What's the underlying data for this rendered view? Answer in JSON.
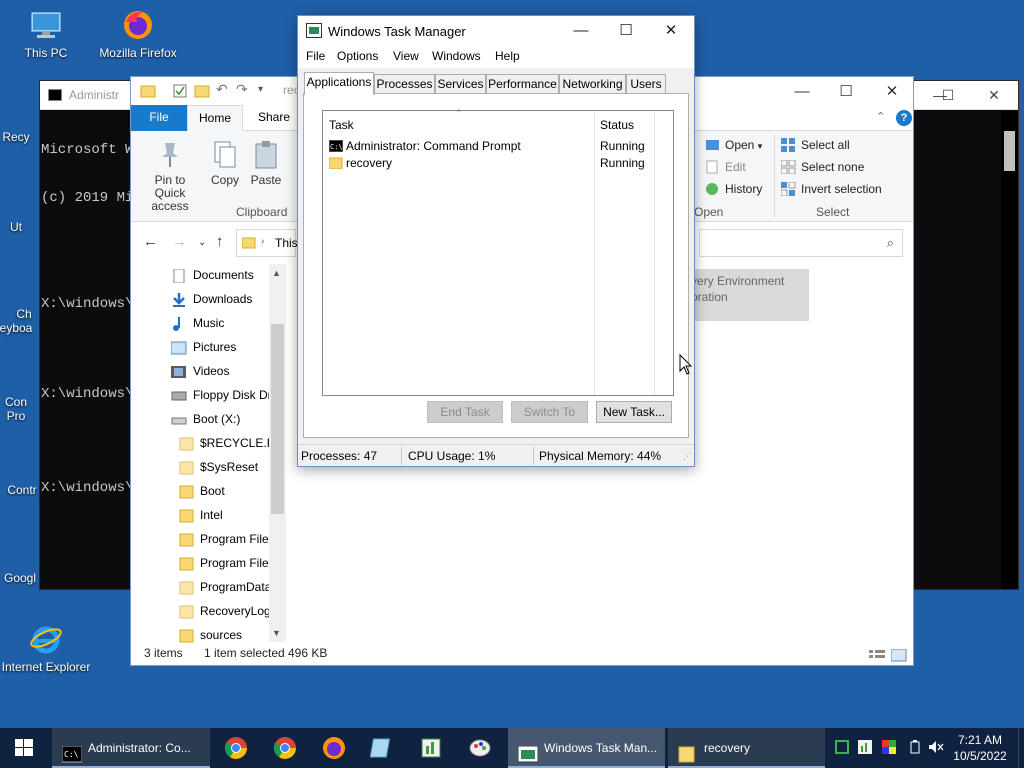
{
  "desktop": {
    "icons": [
      {
        "label": "This PC"
      },
      {
        "label": "Mozilla Firefox"
      },
      {
        "label": "Recy"
      },
      {
        "label": "Ut"
      },
      {
        "label": "Ch"
      },
      {
        "label": "Keyboa"
      },
      {
        "label": "Con"
      },
      {
        "label": "Pro"
      },
      {
        "label": "Contr"
      },
      {
        "label": "Googl"
      },
      {
        "label": "Internet Explorer"
      }
    ]
  },
  "cmd": {
    "title": "Administr",
    "lines": [
      "Microsoft Wi",
      "(c) 2019 Mic",
      "",
      "X:\\windows\\S",
      "",
      "X:\\windows\\S",
      "",
      "X:\\windows\\S"
    ]
  },
  "explorer": {
    "title_fragment": "recy",
    "tabs": {
      "file": "File",
      "home": "Home",
      "share": "Share"
    },
    "ribbon": {
      "pin_label": "Pin to Quick access",
      "copy_label": "Copy",
      "paste_label": "Paste",
      "clipboard_group": "Clipboard",
      "open_label": "Open",
      "edit_label": "Edit",
      "history_label": "History",
      "open_group": "Open",
      "select_all": "Select all",
      "select_none": "Select none",
      "invert_selection": "Invert selection",
      "select_group": "Select"
    },
    "address": "This",
    "nav_items": [
      "Documents",
      "Downloads",
      "Music",
      "Pictures",
      "Videos",
      "Floppy Disk Dri",
      "Boot (X:)",
      "$RECYCLE.BIN",
      "$SysReset",
      "Boot",
      "Intel",
      "Program Files",
      "Program Files",
      "ProgramData",
      "RecoveryLogs",
      "sources"
    ],
    "content_lines": [
      "very Environment",
      "oration"
    ],
    "status": {
      "items": "3 items",
      "selected": "1 item selected",
      "size": "496 KB"
    }
  },
  "taskmanager": {
    "title": "Windows Task Manager",
    "menu": [
      "File",
      "Options",
      "View",
      "Windows",
      "Help"
    ],
    "tabs": [
      "Applications",
      "Processes",
      "Services",
      "Performance",
      "Networking",
      "Users"
    ],
    "columns": {
      "task": "Task",
      "status": "Status"
    },
    "rows": [
      {
        "task": "Administrator: Command Prompt",
        "status": "Running"
      },
      {
        "task": "recovery",
        "status": "Running"
      }
    ],
    "buttons": {
      "end_task": "End Task",
      "switch_to": "Switch To",
      "new_task": "New Task..."
    },
    "status": {
      "processes": "Processes: 47",
      "cpu": "CPU Usage: 1%",
      "memory": "Physical Memory: 44%"
    }
  },
  "taskbar": {
    "apps": [
      {
        "label": "Administrator: Co..."
      },
      {
        "label": "Windows Task Man..."
      },
      {
        "label": "recovery"
      }
    ],
    "clock": {
      "time": "7:21 AM",
      "date": "10/5/2022"
    }
  },
  "colors": {
    "desktop": "#1f5fa8",
    "accent": "#1979ca",
    "taskbar": "#0f2340"
  }
}
